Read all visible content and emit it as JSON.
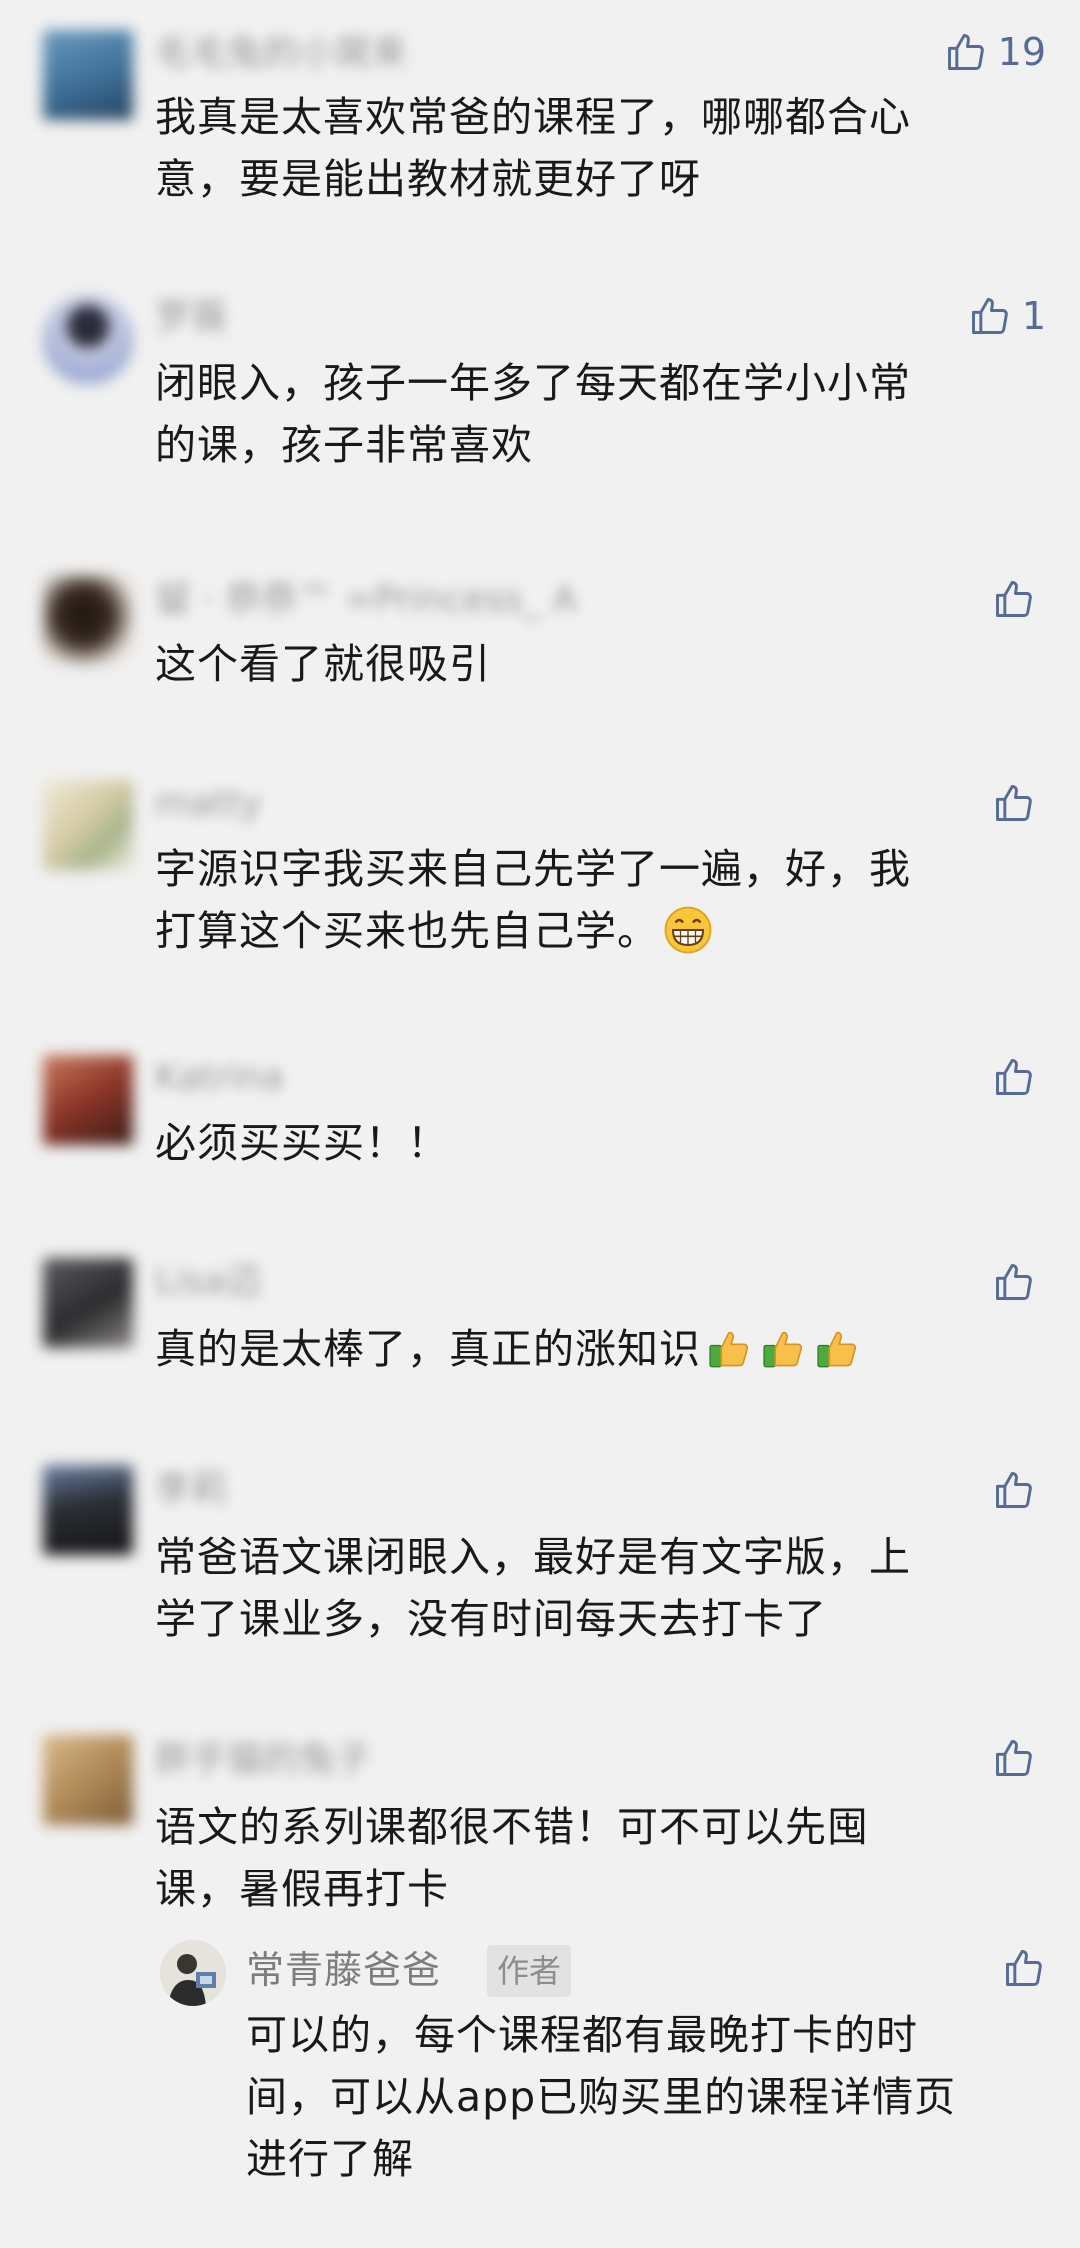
{
  "comments": [
    {
      "name": "毛毛兔的小窝来",
      "likes": "19",
      "lines": [
        "我真是太喜欢常爸的课程了，哪哪都合心",
        "意，要是能出教材就更好了呀"
      ],
      "avatar_color": "#4d7fa6"
    },
    {
      "name": "罗薇",
      "likes": "1",
      "lines": [
        "闭眼入，孩子一年多了每天都在学小小常",
        "的课，孩子非常喜欢"
      ],
      "avatar_color": "#b9c3de"
    },
    {
      "name": "留 · 恭恭™ ∞Princess_ A",
      "likes": "",
      "lines": [
        "这个看了就很吸引"
      ],
      "avatar_color": "#4a3a30"
    },
    {
      "name": "matty",
      "likes": "",
      "lines": [
        "字源识字我买来自己先学了一遍，好，我",
        "打算这个买来也先自己学。"
      ],
      "emoji_after_last": "grin-emoji",
      "avatar_color": "#d8d0b4"
    },
    {
      "name": "Katrina",
      "likes": "",
      "lines": [
        "必须买买买！！"
      ],
      "avatar_color": "#9a4b3c"
    },
    {
      "name": "Lisa迈",
      "likes": "",
      "lines": [
        "真的是太棒了，真正的涨知识"
      ],
      "emoji_after_last": "thumbs-up-emoji-x3",
      "avatar_color": "#3f3e40"
    },
    {
      "name": "李莉",
      "likes": "",
      "lines": [
        "常爸语文课闭眼入，最好是有文字版，上",
        "学了课业多，没有时间每天去打卡了"
      ],
      "avatar_color": "#2d2f35"
    },
    {
      "name": "胖乎猫的兔子",
      "likes": "",
      "lines": [
        "语文的系列课都很不错！可不可以先囤",
        "课，暑假再打卡"
      ],
      "avatar_color": "#b8966a"
    }
  ],
  "reply": {
    "name": "常青藤爸爸",
    "badge": "作者",
    "lines": [
      "可以的，每个课程都有最晚打卡的时",
      "间，可以从app已购买里的课程详情页",
      "进行了解"
    ]
  },
  "colors": {
    "background": "#f1f1f1",
    "like_icon": "#576b95",
    "text": "#191919",
    "name": "#9a9a9a"
  },
  "icons": {
    "like": "thumbs-up-outline-icon"
  }
}
